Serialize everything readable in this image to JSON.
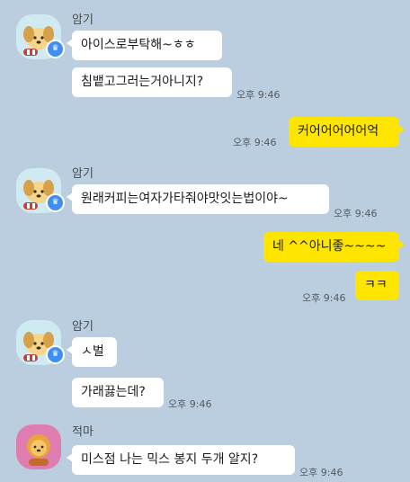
{
  "messages": {
    "m1_sender": "암기",
    "m1_text1": "아이스로부탁해~ㅎㅎ",
    "m1_text2": "침뱉고그러는거아니지?",
    "m1_time": "오후 9:46",
    "o1_text": "커어어어어어억",
    "o1_time": "오후 9:46",
    "m2_sender": "암기",
    "m2_text": "원래커피는여자가타줘야맛잇는법이야~",
    "m2_time": "오후 9:46",
    "o2_text1": "네 ^^아니좋~~~~",
    "o2_text2": "ㅋㅋ",
    "o2_time": "오후 9:46",
    "m3_sender": "암기",
    "m3_text1": "ㅅ벌",
    "m3_text2": "가래끓는데?",
    "m3_time": "오후 9:46",
    "m4_sender": "적마",
    "m4_text": "미스점 나는 믹스 봉지 두개 알지?",
    "m4_time": "오후 9:46"
  },
  "icons": {
    "crown": "crown-icon",
    "avatar_amgi": "dog-character-avatar",
    "avatar_jeokma": "lion-character-avatar"
  },
  "colors": {
    "background": "#bacee0",
    "my_bubble": "#fee500",
    "their_bubble": "#ffffff",
    "crown_badge": "#3f8ef3",
    "jeokma_avatar_bg": "#e07db0"
  }
}
